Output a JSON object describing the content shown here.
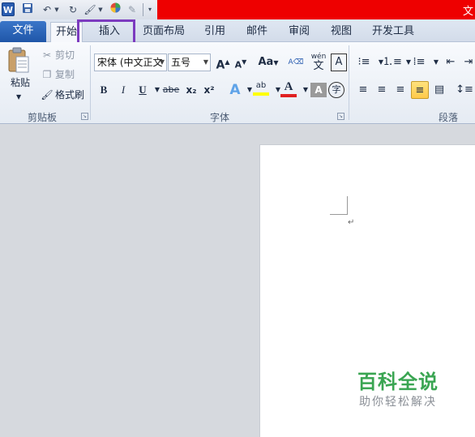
{
  "quick_access": {
    "app_icon": "W",
    "save_icon": "save-icon",
    "undo_icon": "undo-icon",
    "redo_icon": "redo-icon",
    "title_fragment": "文"
  },
  "tabs": {
    "file": "文件",
    "home": "开始",
    "insert": "插入",
    "layout": "页面布局",
    "references": "引用",
    "mailings": "邮件",
    "review": "审阅",
    "view": "视图",
    "developer": "开发工具"
  },
  "clipboard": {
    "paste": "粘贴",
    "cut": "剪切",
    "copy": "复制",
    "format_painter": "格式刷",
    "group_label": "剪贴板"
  },
  "font": {
    "font_name": "宋体 (中文正文",
    "font_size": "五号",
    "grow": "A",
    "shrink": "A",
    "change_case": "Aa",
    "pinyin": "wén",
    "phonetic": "文",
    "border": "A",
    "bold": "B",
    "italic": "I",
    "underline": "U",
    "strike": "abe",
    "subscript": "x₂",
    "superscript": "x²",
    "text_effect": "A",
    "highlight": "ab",
    "font_color": "A",
    "char_shading": "A",
    "enclose": "字",
    "group_label": "字体"
  },
  "paragraph": {
    "group_label": "段落"
  },
  "watermark": {
    "title": "百科全说",
    "subtitle": "助你轻松解决"
  },
  "colors": {
    "title_bar": "#ee0000",
    "file_tab": "#1f56a8",
    "highlight_box": "#7c3bbf",
    "watermark_green": "#3aa552"
  }
}
